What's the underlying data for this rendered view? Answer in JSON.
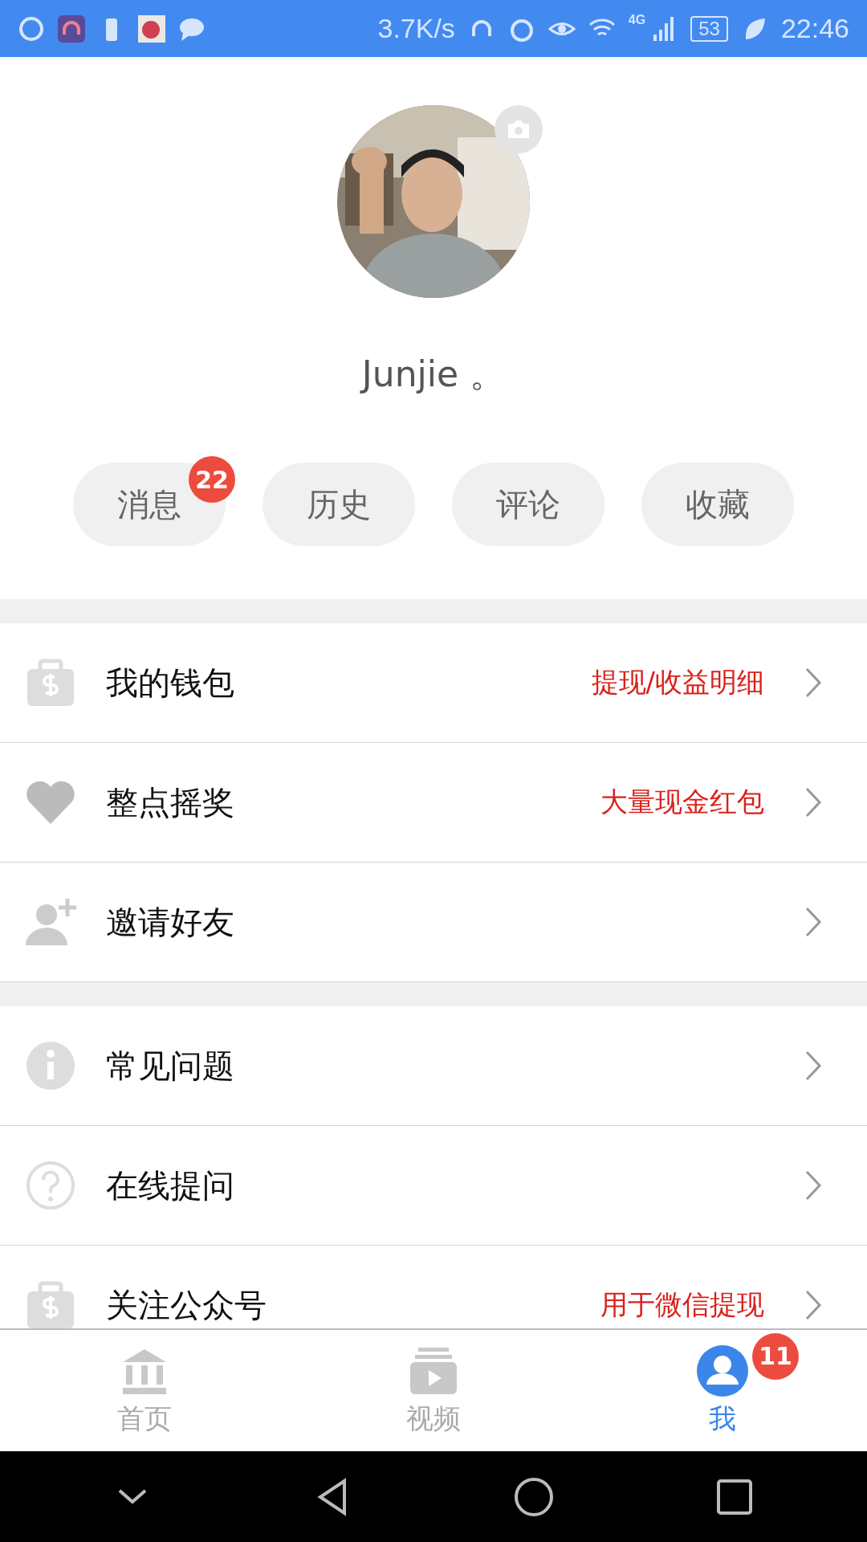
{
  "status_bar": {
    "speed": "3.7K/s",
    "network": "4G",
    "battery": "53",
    "time": "22:46"
  },
  "profile": {
    "name": "Junjie 。"
  },
  "chips": [
    {
      "label": "消息",
      "badge": "22"
    },
    {
      "label": "历史"
    },
    {
      "label": "评论"
    },
    {
      "label": "收藏"
    }
  ],
  "sections": [
    {
      "items": [
        {
          "label": "我的钱包",
          "note": "提现/收益明细"
        },
        {
          "label": "整点摇奖",
          "note": "大量现金红包"
        },
        {
          "label": "邀请好友"
        }
      ]
    },
    {
      "items": [
        {
          "label": "常见问题"
        },
        {
          "label": "在线提问"
        },
        {
          "label": "关注公众号",
          "note": "用于微信提现"
        }
      ]
    }
  ],
  "tabs": [
    {
      "label": "首页",
      "selected": false
    },
    {
      "label": "视频",
      "selected": false
    },
    {
      "label": "我",
      "selected": true,
      "badge": "11"
    }
  ]
}
